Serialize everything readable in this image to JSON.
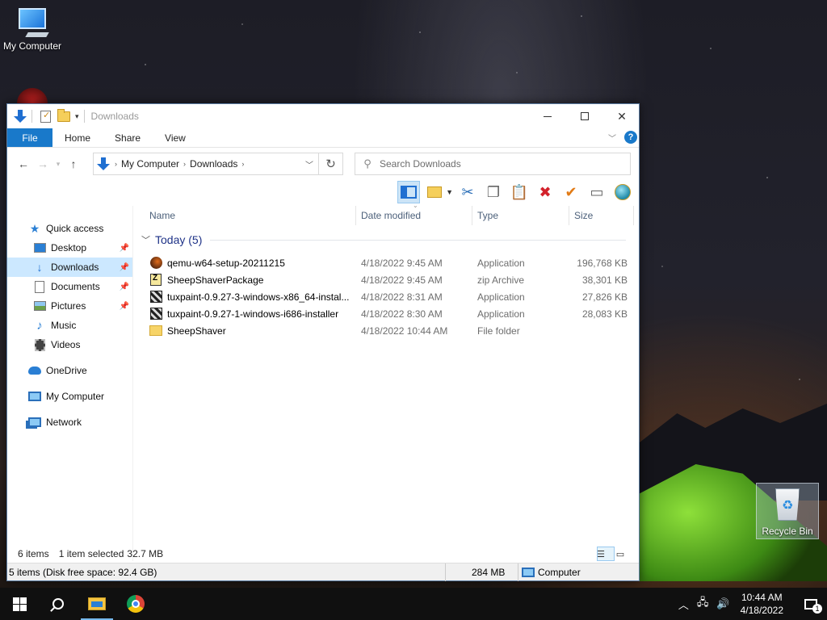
{
  "desktop": {
    "icons": {
      "my_computer": "My Computer",
      "recycle_bin": "Recycle Bin"
    }
  },
  "window": {
    "title": "Downloads",
    "ribbon_tabs": [
      "File",
      "Home",
      "Share",
      "View"
    ],
    "help_label": "?",
    "address": {
      "root_glyph": "›",
      "crumbs": [
        "My Computer",
        "Downloads"
      ]
    },
    "search": {
      "placeholder": "Search Downloads"
    },
    "nav_pane": {
      "quick_access": "Quick access",
      "items": [
        "Desktop",
        "Downloads",
        "Documents",
        "Pictures",
        "Music",
        "Videos"
      ],
      "onedrive": "OneDrive",
      "my_computer": "My Computer",
      "network": "Network"
    },
    "columns": {
      "name": "Name",
      "date": "Date modified",
      "type": "Type",
      "size": "Size"
    },
    "group": {
      "label": "Today (5)"
    },
    "files": [
      {
        "name": "qemu-w64-setup-20211215",
        "date": "4/18/2022 9:45 AM",
        "type": "Application",
        "size": "196,768 KB",
        "icon": "qemu-icon"
      },
      {
        "name": "SheepShaverPackage",
        "date": "4/18/2022 9:45 AM",
        "type": "zip Archive",
        "size": "38,301 KB",
        "icon": "zip-icon"
      },
      {
        "name": "tuxpaint-0.9.27-3-windows-x86_64-instal...",
        "date": "4/18/2022 8:31 AM",
        "type": "Application",
        "size": "27,826 KB",
        "icon": "installer-icon"
      },
      {
        "name": "tuxpaint-0.9.27-1-windows-i686-installer",
        "date": "4/18/2022 8:30 AM",
        "type": "Application",
        "size": "28,083 KB",
        "icon": "installer-icon"
      },
      {
        "name": "SheepShaver",
        "date": "4/18/2022 10:44 AM",
        "type": "File folder",
        "size": "",
        "icon": "folder-icon"
      }
    ],
    "status": {
      "items": "6 items",
      "selected": "1 item selected",
      "selected_size": "32.7 MB"
    },
    "bottom_status": {
      "free_space": "5 items (Disk free space: 92.4 GB)",
      "size": "284 MB",
      "location": "Computer"
    }
  },
  "taskbar": {
    "time": "10:44 AM",
    "date": "4/18/2022",
    "notification_count": "1"
  },
  "colors": {
    "accent": "#1979ca",
    "selection": "#cce8ff",
    "group_header": "#1e3287"
  }
}
